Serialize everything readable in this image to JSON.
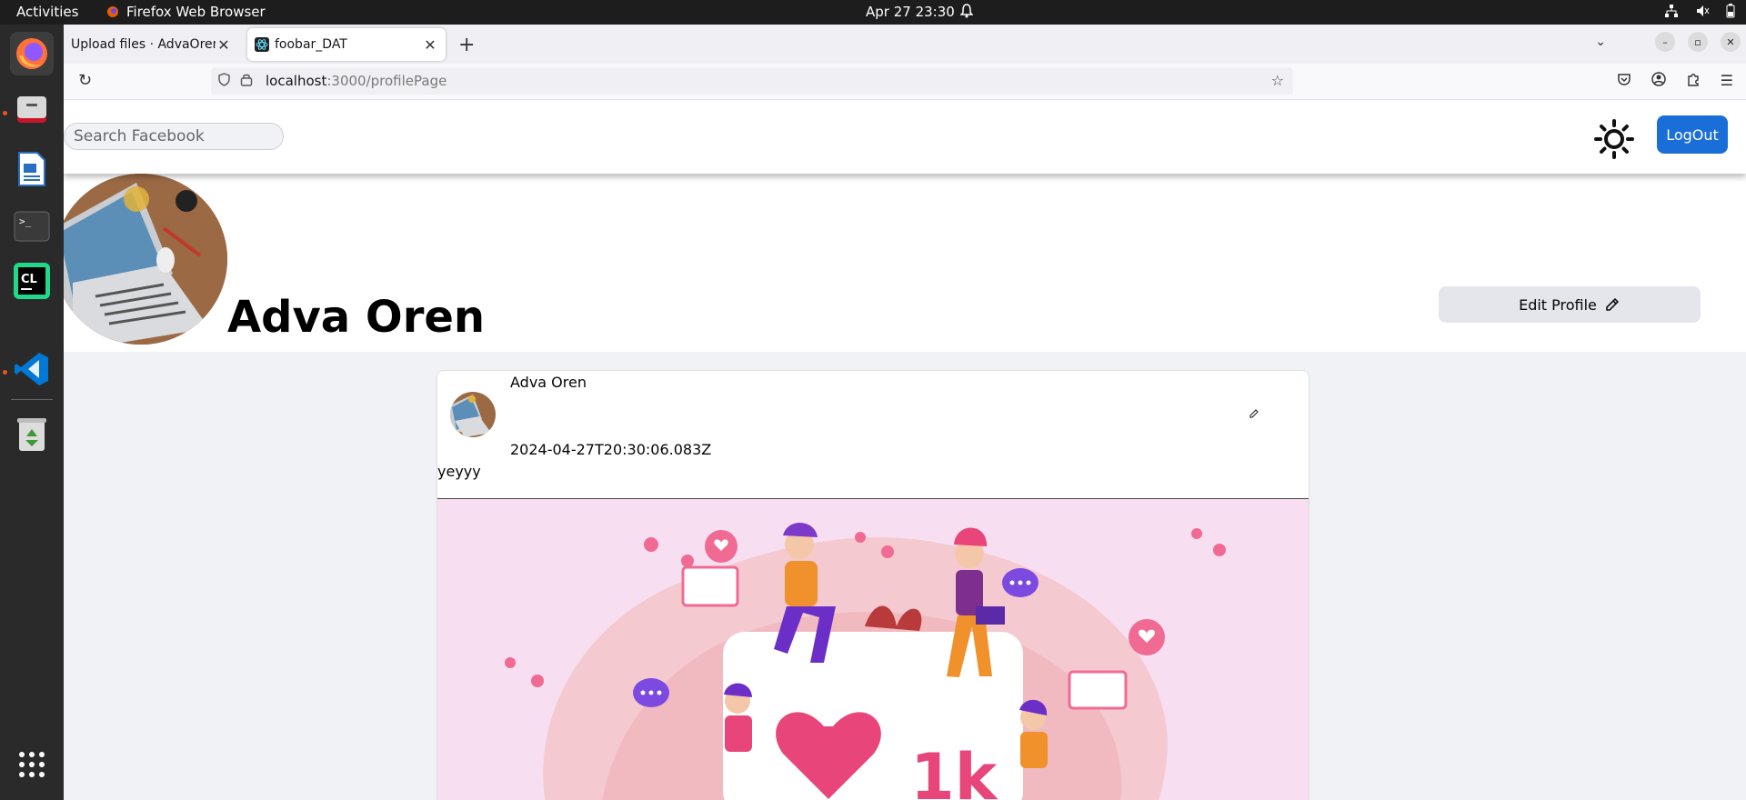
{
  "system": {
    "activities": "Activities",
    "app_name": "Firefox Web Browser",
    "clock": "Apr 27  23:30"
  },
  "browser": {
    "tabs": [
      {
        "title": "Upload files · AdvaOren/f",
        "active": false
      },
      {
        "title": "foobar_DAT",
        "active": true
      }
    ],
    "url_host": "localhost",
    "url_path": ":3000/profilePage"
  },
  "header": {
    "search_placeholder": "Search Facebook",
    "logout_label": "LogOut"
  },
  "profile": {
    "name": "Adva Oren",
    "edit_label": "Edit Profile"
  },
  "post": {
    "author": "Adva Oren",
    "timestamp": "2024-04-27T20:30:06.083Z",
    "text": "yeyyy",
    "image_caption": "1k"
  },
  "colors": {
    "primary": "#1a6ed8",
    "page_bg": "#f0f2f5",
    "topbar": "#1d1d1d",
    "dock": "#2a2a2a"
  }
}
